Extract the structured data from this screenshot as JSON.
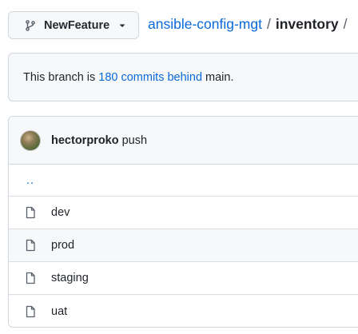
{
  "branch_selector": {
    "label": "NewFeature"
  },
  "breadcrumb": {
    "repo": "ansible-config-mgt",
    "separator": "/",
    "folder": "inventory"
  },
  "notice": {
    "prefix": "This branch is",
    "link": "180 commits behind",
    "suffix": "main."
  },
  "commit": {
    "author": "hectorproko",
    "message": "push"
  },
  "files": {
    "parent": "..",
    "items": [
      {
        "name": "dev",
        "icon": "file-icon"
      },
      {
        "name": "prod",
        "icon": "file-icon",
        "hover": true
      },
      {
        "name": "staging",
        "icon": "file-icon"
      },
      {
        "name": "uat",
        "icon": "file-icon"
      }
    ]
  },
  "colors": {
    "link": "#0969da",
    "border": "#d0d7de",
    "subtle_bg": "#f6f8fa",
    "text": "#1f2328"
  }
}
